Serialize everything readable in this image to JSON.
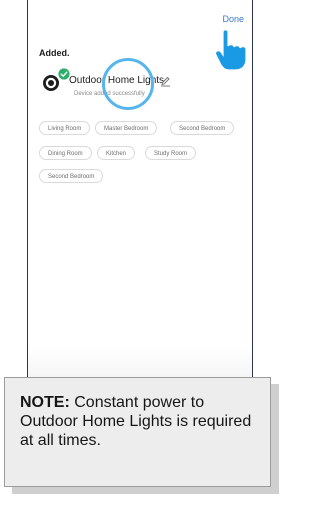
{
  "header": {
    "done_label": "Done"
  },
  "main": {
    "title": "Added.",
    "device": {
      "name": "Outdoor Home Lights",
      "status": "Device added successfully"
    },
    "rooms": [
      "Living Room",
      "Master Bedroom",
      "Second Bedroom",
      "Dining Room",
      "Kitchen",
      "Study Room",
      "Second Bedroom"
    ]
  },
  "note": {
    "label": "NOTE:",
    "text": "Constant power to Outdoor Home Lights is required at all times."
  },
  "icons": {
    "device": "smart-plug-icon",
    "badge": "check-icon",
    "edit": "pencil-icon",
    "pointer": "hand-pointer-icon"
  },
  "colors": {
    "accent": "#3b79c7",
    "success": "#2eae6b",
    "highlight": "#55b5ec",
    "pointer": "#1a9ae4"
  }
}
